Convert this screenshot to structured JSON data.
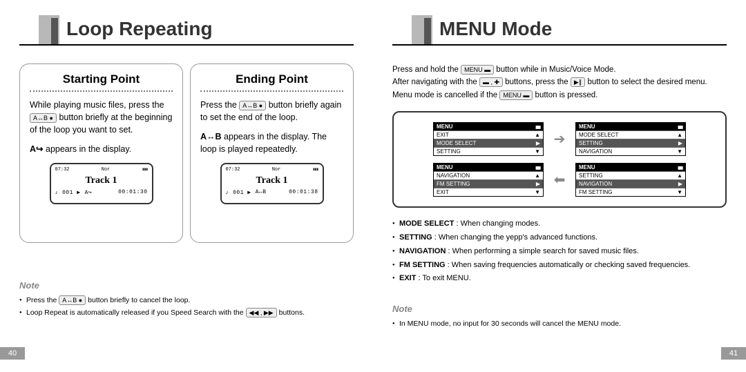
{
  "left": {
    "title": "Loop Repeating",
    "page_num": "40",
    "starting": {
      "heading": "Starting Point",
      "p1a": "While playing music files, press the ",
      "p1b": " button briefly at the beginning of the loop you want to set.",
      "p2a": "A",
      "p2b": " appears in the display.",
      "btn": "A↔B ●",
      "lcd": {
        "clock": "07:32",
        "eq": "Nor",
        "track": "Track 1",
        "idx": "♪ 001 ▶",
        "loop": "A↪",
        "time": "00:01:30"
      }
    },
    "ending": {
      "heading": "Ending Point",
      "p1a": "Press the ",
      "p1b": " button briefly again to set the end of the loop.",
      "p2a": "A↔B",
      "p2b": " appears in the display. The loop is played repeatedly.",
      "btn": "A↔B ●",
      "lcd": {
        "clock": "07:32",
        "eq": "Nor",
        "track": "Track 1",
        "idx": "♪ 001 ▶",
        "loop": "A↔B",
        "time": "00:01:38"
      }
    },
    "note_label": "Note",
    "notes": {
      "n1a": "Press the ",
      "n1b": " button briefly to cancel the loop.",
      "n1btn": "A↔B ●",
      "n2a": "Loop Repeat is automatically released if you Speed Search with the ",
      "n2b": " buttons.",
      "n2btn": "◀◀ , ▶▶"
    }
  },
  "right": {
    "title": "MENU Mode",
    "page_num": "41",
    "intro": {
      "l1a": "Press and hold the ",
      "l1b": " button while in Music/Voice Mode.",
      "l1btn": "MENU ▬",
      "l2a": "After navigating with the ",
      "l2b": " buttons, press the ",
      "l2c": " button to select the desired menu.",
      "l2btn1": "▬ , ✚",
      "l2btn2": "▶∥",
      "l3a": "Menu mode is cancelled if the ",
      "l3b": " button is pressed.",
      "l3btn": "MENU ▬"
    },
    "screens": {
      "s1": {
        "head": "MENU",
        "r1": "EXIT",
        "r2": "MODE SELECT",
        "r3": "SETTING",
        "sel": 2
      },
      "s2": {
        "head": "MENU",
        "r1": "MODE SELECT",
        "r2": "SETTING",
        "r3": "NAVIGATION",
        "sel": 1
      },
      "s3": {
        "head": "MENU",
        "r1": "NAVIGATION",
        "r2": "FM SETTING",
        "r3": "EXIT",
        "sel": 1
      },
      "s4": {
        "head": "MENU",
        "r1": "SETTING",
        "r2": "NAVIGATION",
        "r3": "FM SETTING",
        "sel": 1
      }
    },
    "defs": {
      "d1": "MODE SELECT : When changing modes.",
      "d2": "SETTING : When changing the yepp's advanced functions.",
      "d3": "NAVIGATION : When performing a simple search for saved music files.",
      "d4": "FM SETTING : When saving frequencies automatically or checking saved frequencies.",
      "d5": "EXIT : To exit MENU."
    },
    "note_label": "Note",
    "note1": "In MENU mode, no input for 30 seconds will cancel the MENU mode."
  }
}
